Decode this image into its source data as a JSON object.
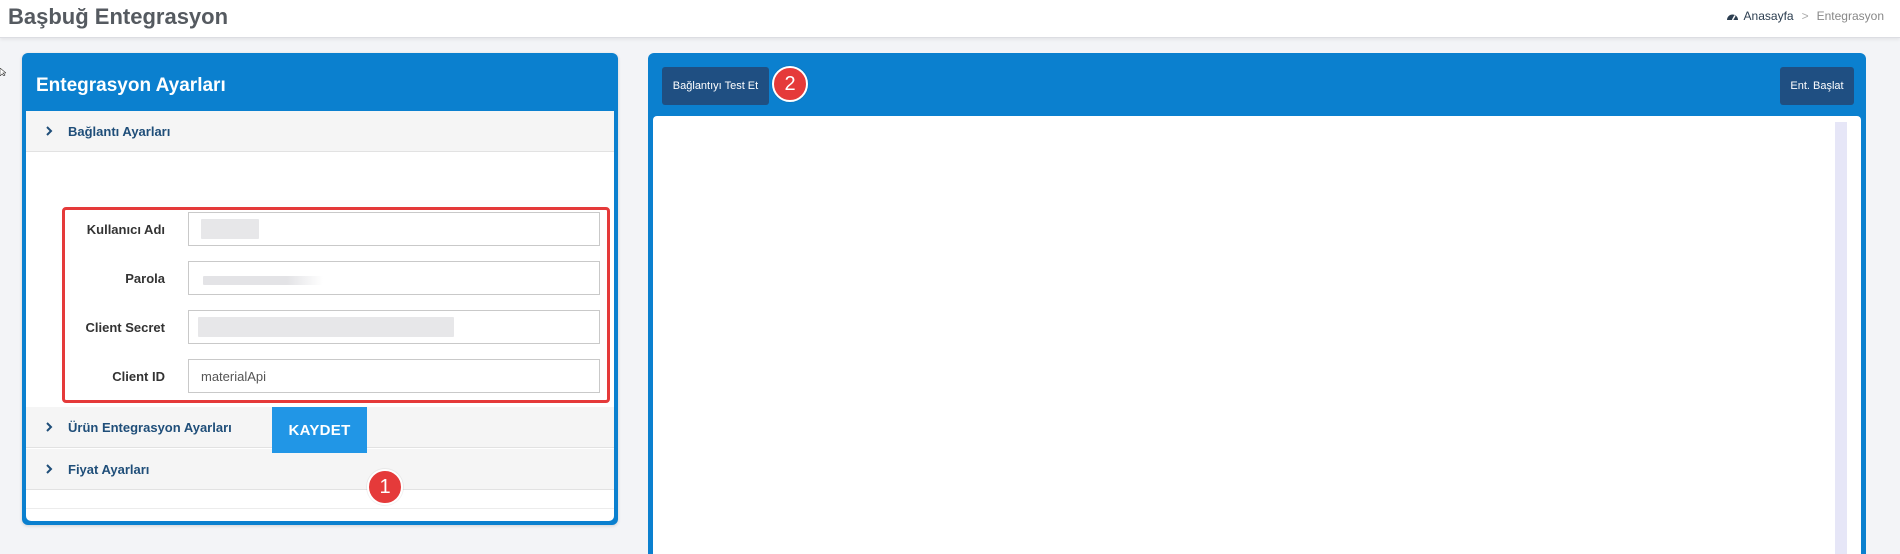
{
  "header": {
    "title": "Başbuğ Entegrasyon",
    "breadcrumb": {
      "home": "Anasayfa",
      "separator": ">",
      "current": "Entegrasyon"
    }
  },
  "left_panel": {
    "title": "Entegrasyon Ayarları",
    "sections": [
      {
        "label": "Bağlantı Ayarları"
      },
      {
        "label": "Ürün Entegrasyon Ayarları"
      },
      {
        "label": "Fiyat Ayarları"
      }
    ],
    "fields": [
      {
        "label": "Kullanıcı Adı",
        "value": "",
        "masked": true
      },
      {
        "label": "Parola",
        "value": "",
        "masked": true
      },
      {
        "label": "Client Secret",
        "value": "",
        "masked": true
      },
      {
        "label": "Client ID",
        "value": "materialApi",
        "masked": false
      }
    ],
    "save_button": "KAYDET",
    "badge": "1"
  },
  "right_panel": {
    "test_button": "Bağlantıyı Test Et",
    "start_button": "Ent. Başlat",
    "badge": "2"
  },
  "colors": {
    "panel_blue": "#0b80cf",
    "button_dark": "#1f4f82",
    "save_blue": "#2196e6",
    "highlight_red": "#e53a3a"
  }
}
